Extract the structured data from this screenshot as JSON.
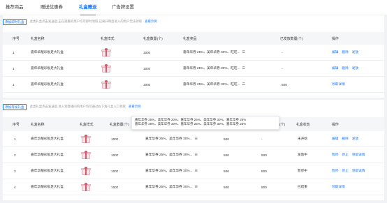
{
  "tabs": [
    {
      "label": "推荐商品",
      "active": false
    },
    {
      "label": "赠送优惠券",
      "active": false
    },
    {
      "label": "礼盒赠送",
      "active": true
    },
    {
      "label": "广告牌设置",
      "active": false
    }
  ],
  "section1": {
    "add_label": "添加即时礼盒",
    "hint": "此类礼盒点击发送后,正在观看的用户均可即时领取,已离开和后进入的用户无法领取",
    "example_link": "查看示例",
    "columns": [
      "序号",
      "礼盒名称",
      "礼盒样式",
      "礼盒数量(个)",
      "礼盒奖品",
      "已发放数量(个)",
      "操作"
    ],
    "rows": [
      {
        "index": "1",
        "name": "嘉年华靓彩板足大礼盒",
        "quantity": "1000",
        "prize": "嘉年华券 25%、美年华券 30%、旺旺...",
        "issued": "-",
        "actions": [
          "编辑",
          "删除",
          "发放"
        ]
      },
      {
        "index": "1",
        "name": "嘉年华靓彩板足大礼盒",
        "quantity": "1000",
        "prize": "嘉年华券 25%、美年华券 30%、旺旺...",
        "issued": "-",
        "actions": [
          "编辑",
          "删除",
          "发放"
        ]
      },
      {
        "index": "1",
        "name": "嘉年华靓彩板足大礼盒",
        "quantity": "1000",
        "prize": "嘉年华券 25%、美年华券 30%、旺旺...",
        "issued": "500",
        "actions": [
          "领取详情"
        ]
      }
    ]
  },
  "section2": {
    "add_label": "添加等候礼盒",
    "hint": "此类礼盒点击发送后,进入到直播间的用户均可通过右下角礼盒入口领取",
    "example_link": "查看示例",
    "columns": [
      "序号",
      "礼盒名称",
      "礼盒样式",
      "礼盒数量(个)",
      "礼盒奖品",
      "",
      "(个)",
      "礼盒状态",
      "操作"
    ],
    "rows": [
      {
        "index": "1",
        "name": "嘉年华靓彩板足大礼盒",
        "quantity": "1000",
        "prize": "嘉年华券 25%、美年华券 30%...",
        "c5": "500",
        "c6": "-",
        "status": "未开始",
        "actions": [
          "编辑",
          "删除",
          "发放"
        ]
      },
      {
        "index": "2",
        "name": "嘉年华靓彩板足大礼盒",
        "quantity": "1000",
        "prize": "嘉年华券 25%、美年华券 30%...",
        "c5": "500",
        "c6": "500",
        "status": "发放中",
        "actions": [
          "暂停",
          "停止",
          "领取详情"
        ]
      },
      {
        "index": "3",
        "name": "嘉年华靓彩板足大礼盒",
        "quantity": "1000",
        "prize": "嘉年华券 25%、美年华券 30%...",
        "c5": "500",
        "c6": "500",
        "status": "暂停中",
        "actions": [
          "暂停",
          "停止",
          "领取详情"
        ]
      },
      {
        "index": "4",
        "name": "嘉年华靓彩板足大礼盒",
        "quantity": "1000",
        "prize": "嘉年华券 25%、美年华券 30%...",
        "c5": "500",
        "c6": "500",
        "status": "已结束",
        "actions": [
          "领取详情"
        ]
      }
    ]
  },
  "tooltip": {
    "lines": [
      "嘉年华券 25%、美年华券 30%、嘉年华券 25%、美年华券 30%、嘉年华券 25%",
      "嘉年华券 25%、美年华券 30%、嘉年华券 25%、美年华券 30%、嘉年华券 25%"
    ]
  },
  "icons": {
    "gift_box": "gift-box-icon",
    "list": "list-icon"
  },
  "colors": {
    "accent": "#1677ff",
    "header_bg": "#f5f6f8",
    "hint": "#999999"
  }
}
